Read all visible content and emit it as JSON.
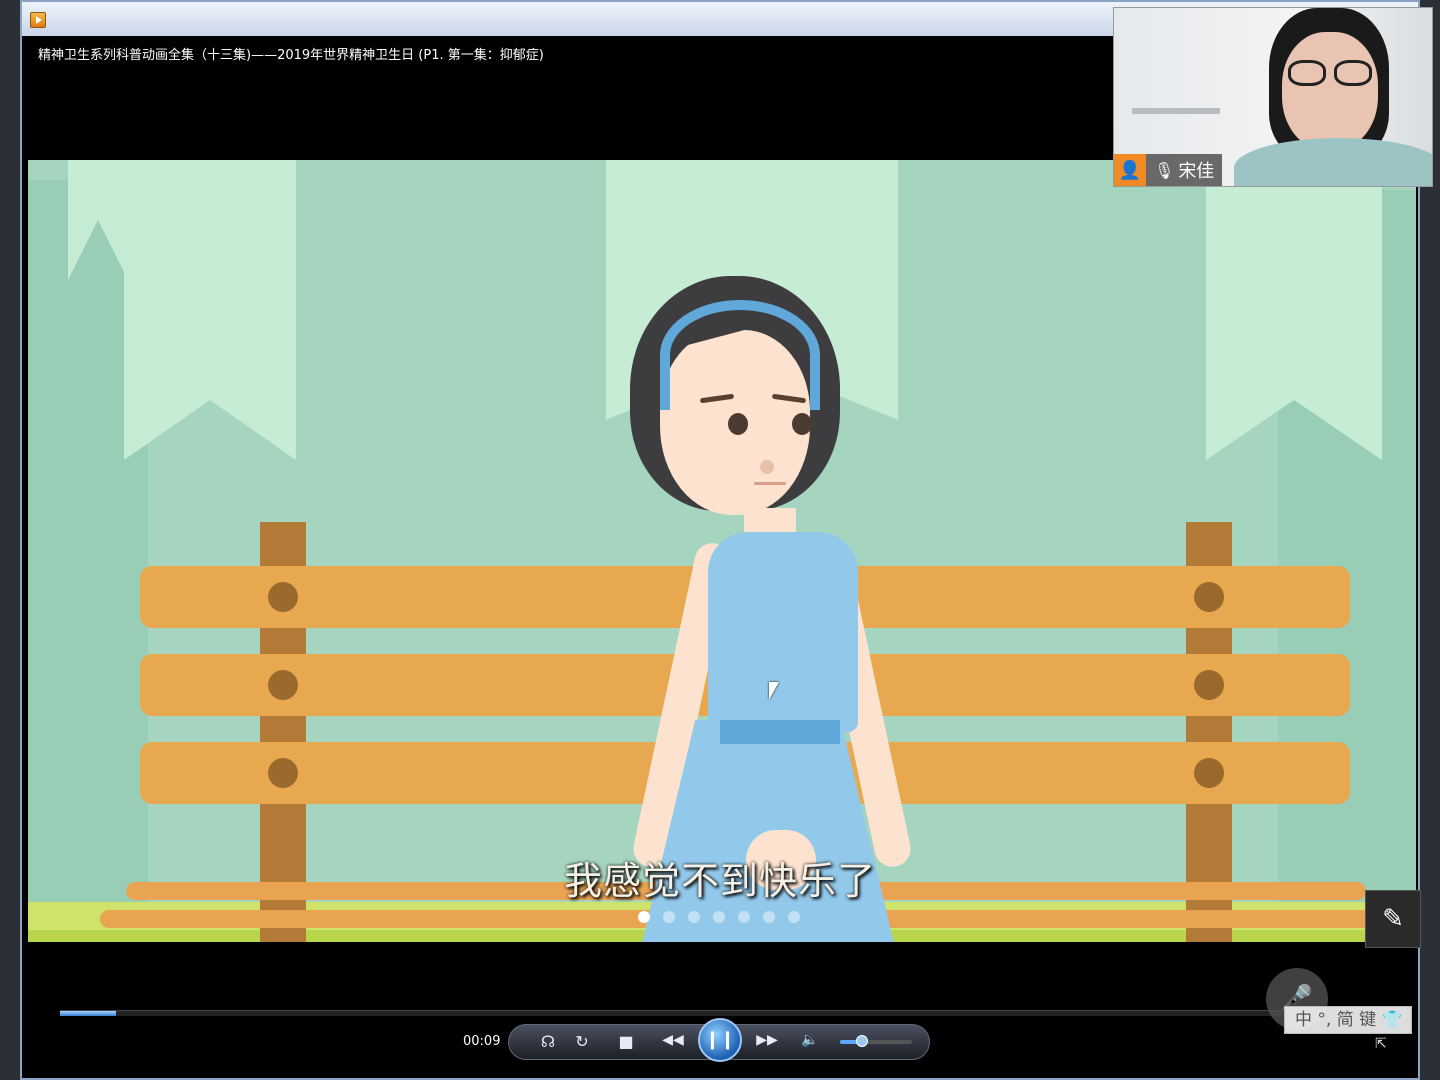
{
  "window": {
    "video_title": "精神卫生系列科普动画全集（十三集)——2019年世界精神卫生日 (P1. 第一集：抑郁症)"
  },
  "video": {
    "subtitle": "我感觉不到快乐了",
    "slide_dots_total": 7,
    "slide_dot_active": 1
  },
  "player": {
    "current_time": "00:09",
    "progress_fraction": 0.045,
    "volume_fraction": 0.3,
    "buttons": {
      "playlist_icon": "☊",
      "repeat_icon": "↻",
      "stop_icon": "■",
      "rewind_icon": "◀◀",
      "pause_icon": "❙❙",
      "forward_icon": "▶▶",
      "volume_icon": "🔈"
    }
  },
  "webcam": {
    "participant_name": "宋佳"
  },
  "overlay": {
    "edit_icon": "✎",
    "mic_muted_icon": "🎤",
    "ime_text": "中 °, 简 键 👕",
    "resize_icon": "⇱"
  },
  "colors": {
    "scene_bg": "#a6d5bf",
    "bench": "#e7a84f",
    "accent_blue": "#5fa8d9",
    "cam_tag_orange": "#f08a24"
  }
}
